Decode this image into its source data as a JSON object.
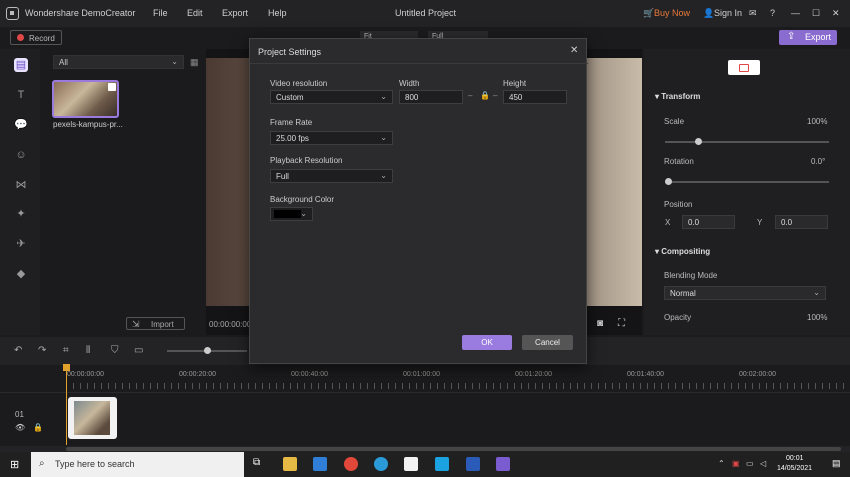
{
  "app": {
    "name": "Wondershare DemoCreator",
    "menu": [
      "File",
      "Edit",
      "Export",
      "Help"
    ],
    "project_title": "Untitled Project",
    "buy_now": "Buy Now",
    "sign_in": "Sign In",
    "accent": "#8a6bd0"
  },
  "toolbar": {
    "record": "Record",
    "export": "Export",
    "fit_label": "Fit",
    "full_label": "Full"
  },
  "media": {
    "filter": "All",
    "items": [
      {
        "name": "pexels-kampus-pr..."
      }
    ],
    "import": "Import"
  },
  "preview": {
    "timecode": "00:00:00:00"
  },
  "properties": {
    "transform": {
      "heading": "Transform",
      "scale_label": "Scale",
      "scale_value": "100%",
      "scale_fraction": 0.2,
      "rotation_label": "Rotation",
      "rotation_value": "0.0°",
      "rotation_fraction": 0.0,
      "position_label": "Position",
      "x_label": "X",
      "x_value": "0.0",
      "y_label": "Y",
      "y_value": "0.0"
    },
    "compositing": {
      "heading": "Compositing",
      "blending_label": "Blending Mode",
      "blending_value": "Normal",
      "opacity_label": "Opacity",
      "opacity_value": "100%"
    }
  },
  "timeline": {
    "ticks": [
      "00:00:00:00",
      "00:00:20:00",
      "00:00:40:00",
      "00:01:00:00",
      "00:01:20:00",
      "00:01:40:00",
      "00:02:00:00"
    ],
    "track_number": "01"
  },
  "dialog": {
    "title": "Project Settings",
    "video_resolution_label": "Video resolution",
    "video_resolution_value": "Custom",
    "width_label": "Width",
    "width_value": "800",
    "height_label": "Height",
    "height_value": "450",
    "frame_rate_label": "Frame Rate",
    "frame_rate_value": "25.00 fps",
    "playback_label": "Playback Resolution",
    "playback_value": "Full",
    "background_label": "Background Color",
    "background_color": "#000000",
    "ok": "OK",
    "cancel": "Cancel"
  },
  "taskbar": {
    "search_placeholder": "Type here to search",
    "time": "00:01",
    "date": "14/05/2021"
  }
}
